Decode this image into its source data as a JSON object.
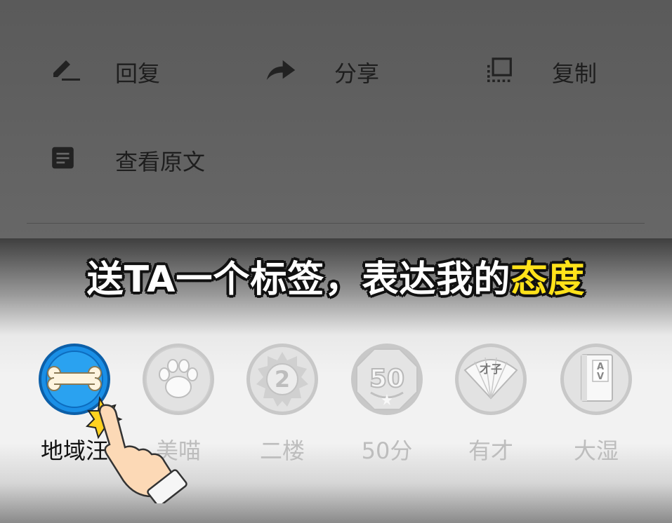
{
  "menu": {
    "items": [
      {
        "label": "回复",
        "icon": "pencil-icon"
      },
      {
        "label": "分享",
        "icon": "share-arrow-icon"
      },
      {
        "label": "复制",
        "icon": "copy-icon"
      },
      {
        "label": "查看原文",
        "icon": "document-icon"
      }
    ]
  },
  "banner": {
    "text": "送TA一个标签，表达我的",
    "highlight": "态度",
    "highlight_color": "#ffe21a"
  },
  "tags": [
    {
      "name": "地域汪",
      "icon": "bone-badge-icon",
      "selected": true
    },
    {
      "name": "美喵",
      "icon": "paw-badge-icon",
      "selected": false
    },
    {
      "name": "二楼",
      "icon": "number-2-badge-icon",
      "selected": false,
      "badge_text": "2"
    },
    {
      "name": "50分",
      "icon": "score-50-badge-icon",
      "selected": false,
      "badge_text": "50"
    },
    {
      "name": "有才",
      "icon": "fan-badge-icon",
      "selected": false,
      "badge_text": "才子"
    },
    {
      "name": "大湿",
      "icon": "book-badge-icon",
      "selected": false,
      "badge_text": "AV"
    }
  ],
  "colors": {
    "active_badge": "#1a8fe6",
    "inactive_badge": "#d8d8d8"
  }
}
